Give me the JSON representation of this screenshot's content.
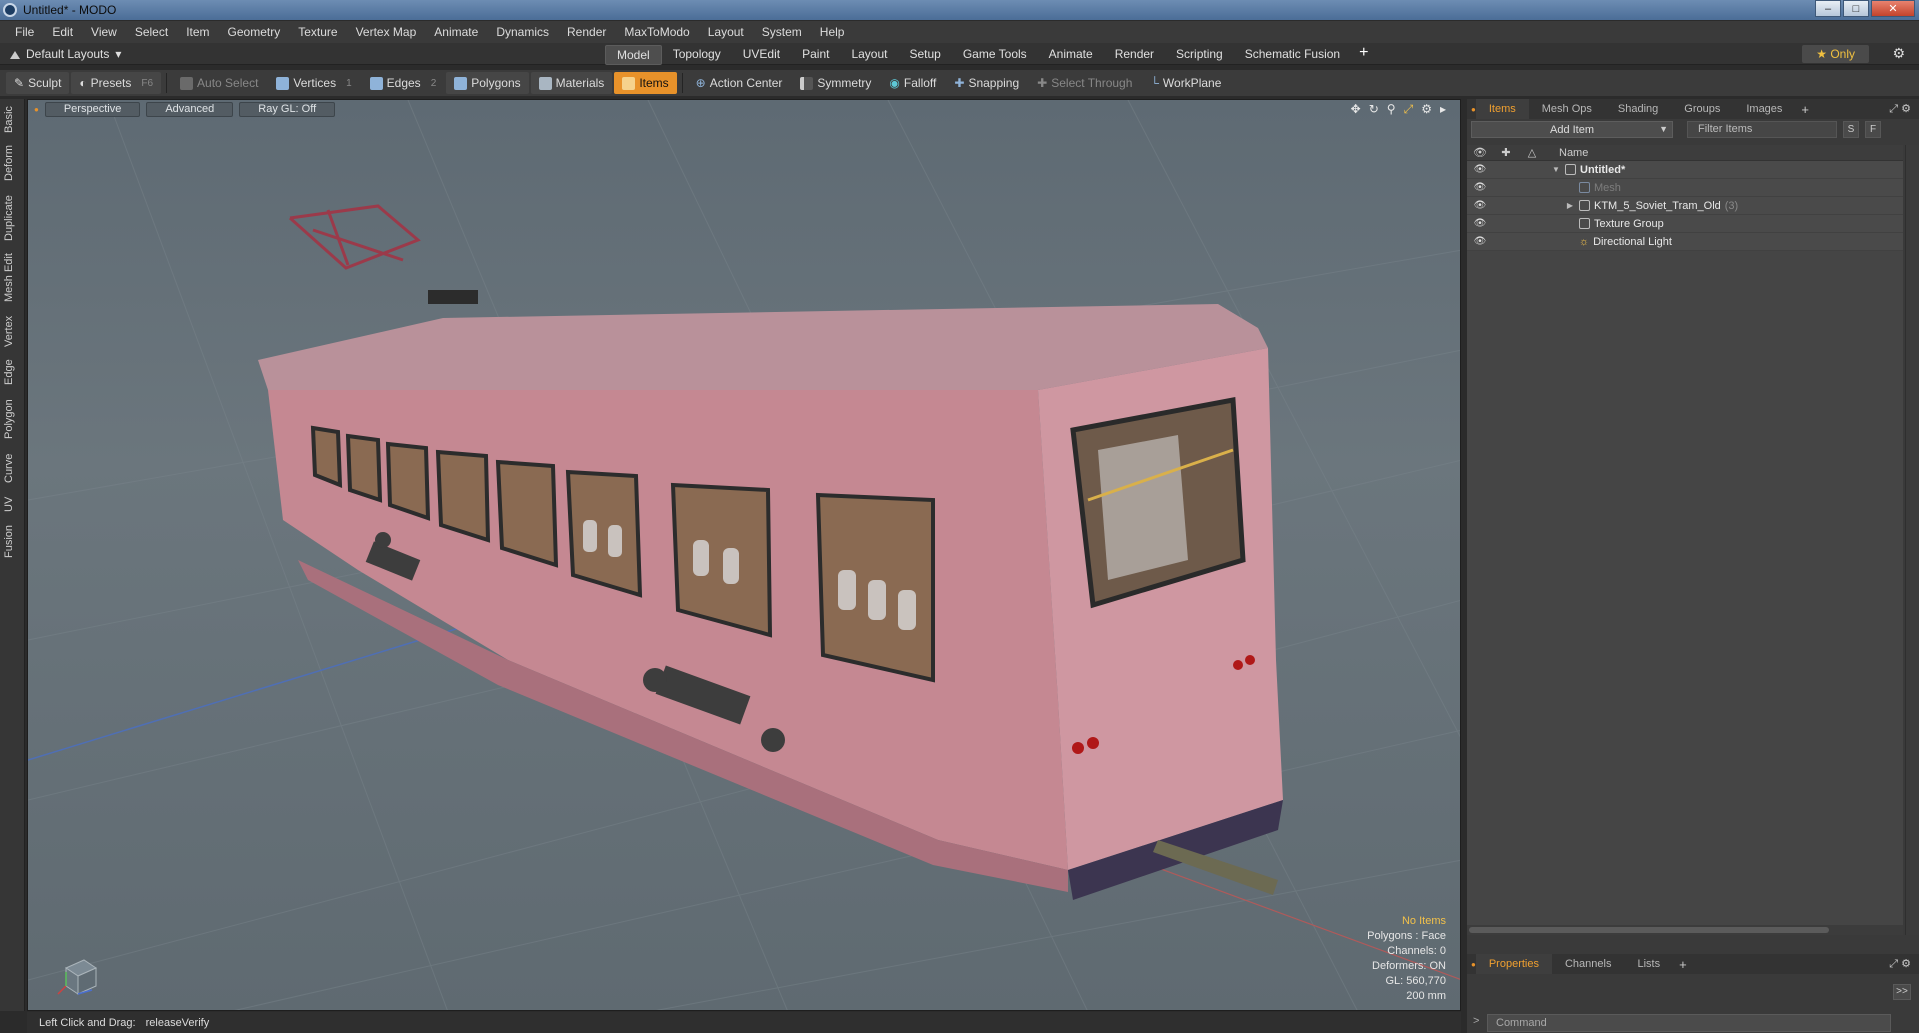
{
  "window": {
    "title": "Untitled* - MODO"
  },
  "menu": [
    "File",
    "Edit",
    "View",
    "Select",
    "Item",
    "Geometry",
    "Texture",
    "Vertex Map",
    "Animate",
    "Dynamics",
    "Render",
    "MaxToModo",
    "Layout",
    "System",
    "Help"
  ],
  "layoutbar": {
    "layouts_label": "Default Layouts",
    "tabs": [
      "Model",
      "Topology",
      "UVEdit",
      "Paint",
      "Layout",
      "Setup",
      "Game Tools",
      "Animate",
      "Render",
      "Scripting",
      "Schematic Fusion"
    ],
    "active_tab": "Model",
    "add": "+",
    "only_label": "★ Only"
  },
  "toolbar": {
    "sculpt": "Sculpt",
    "presets": "Presets",
    "presets_key": "F6",
    "auto_select": "Auto Select",
    "vertices": "Vertices",
    "vertices_key": "1",
    "edges": "Edges",
    "edges_key": "2",
    "polygons": "Polygons",
    "materials": "Materials",
    "items": "Items",
    "action_center": "Action Center",
    "symmetry": "Symmetry",
    "falloff": "Falloff",
    "snapping": "Snapping",
    "select_through": "Select Through",
    "workplane": "WorkPlane"
  },
  "left_tabs": [
    "Basic",
    "Deform",
    "Duplicate",
    "Mesh Edit",
    "Vertex",
    "Edge",
    "Polygon",
    "Curve",
    "UV",
    "Fusion"
  ],
  "viewport": {
    "view": "Perspective",
    "advanced": "Advanced",
    "raygl": "Ray GL: Off",
    "info": {
      "selection": "No Items",
      "polygons": "Polygons : Face",
      "channels": "Channels: 0",
      "deformers": "Deformers: ON",
      "gl": "GL: 560,770",
      "scale": "200 mm"
    }
  },
  "right_panel": {
    "tabs": [
      "Items",
      "Mesh Ops",
      "Shading",
      "Groups",
      "Images"
    ],
    "active_tab": "Items",
    "add_item": "Add Item",
    "filter_placeholder": "Filter Items",
    "s_btn": "S",
    "f_btn": "F",
    "col_name": "Name",
    "tree": [
      {
        "name": "Untitled*",
        "depth": 0,
        "expander": "▼",
        "bold": true
      },
      {
        "name": "Mesh",
        "depth": 1,
        "expander": "",
        "dim": true
      },
      {
        "name": "KTM_5_Soviet_Tram_Old",
        "count": "(3)",
        "depth": 1,
        "expander": "▶"
      },
      {
        "name": "Texture Group",
        "depth": 1,
        "expander": ""
      },
      {
        "name": "Directional Light",
        "depth": 1,
        "expander": ""
      }
    ],
    "props_tabs": [
      "Properties",
      "Channels",
      "Lists"
    ],
    "props_active": "Properties",
    "expand": ">>",
    "command_placeholder": "Command"
  },
  "status": {
    "label": "Left Click and Drag:",
    "value": "releaseVerify"
  },
  "colors": {
    "accent": "#e8922a",
    "viewport_bg": "#66727a",
    "tram_body": "#c98a92"
  }
}
